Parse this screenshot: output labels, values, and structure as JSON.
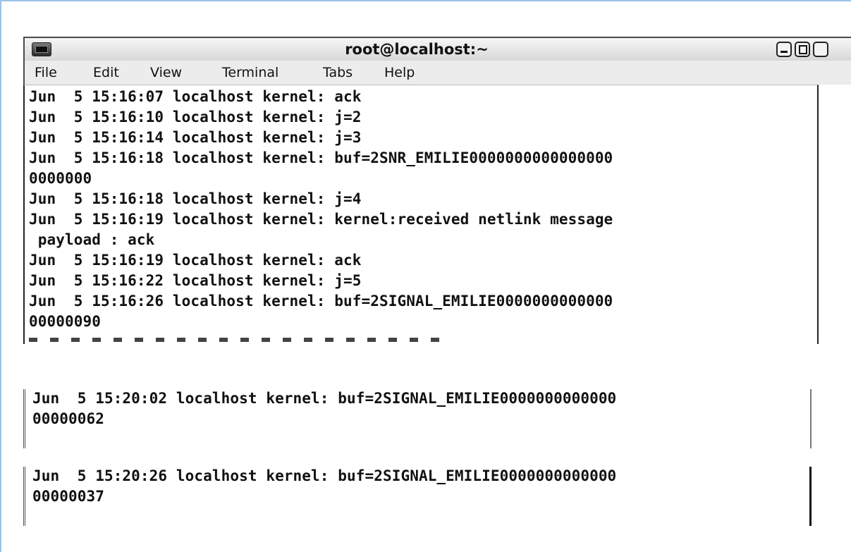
{
  "window": {
    "title": "root@localhost:~",
    "menu": [
      {
        "label": "File",
        "name": "menu-file"
      },
      {
        "label": "Edit",
        "name": "menu-edit"
      },
      {
        "label": "View",
        "name": "menu-view"
      },
      {
        "label": "Terminal",
        "name": "menu-terminal"
      },
      {
        "label": "Tabs",
        "name": "menu-tabs"
      },
      {
        "label": "Help",
        "name": "menu-help"
      }
    ]
  },
  "terminal": {
    "lines": [
      "Jun  5 15:16:07 localhost kernel: ack",
      "Jun  5 15:16:10 localhost kernel: j=2",
      "Jun  5 15:16:14 localhost kernel: j=3",
      "Jun  5 15:16:18 localhost kernel: buf=2SNR_EMILIE0000000000000000",
      "0000000",
      "Jun  5 15:16:18 localhost kernel: j=4",
      "Jun  5 15:16:19 localhost kernel: kernel:received netlink message",
      " payload : ack",
      "Jun  5 15:16:19 localhost kernel: ack",
      "Jun  5 15:16:22 localhost kernel: j=5",
      "Jun  5 15:16:26 localhost kernel: buf=2SIGNAL_EMILIE0000000000000",
      "00000090"
    ]
  },
  "snippets": [
    {
      "lines": [
        "Jun  5 15:20:02 localhost kernel: buf=2SIGNAL_EMILIE0000000000000",
        "00000062"
      ]
    },
    {
      "lines": [
        "Jun  5 15:20:26 localhost kernel: buf=2SIGNAL_EMILIE0000000000000",
        "00000037"
      ]
    }
  ]
}
